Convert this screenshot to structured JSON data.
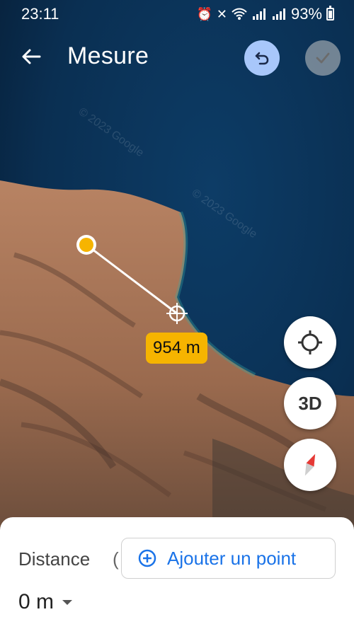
{
  "status_bar": {
    "time": "23:11",
    "battery": "93%",
    "icons": [
      "alarm-icon",
      "mute-icon",
      "wifi-icon",
      "signal-icon",
      "signal-icon",
      "battery-icon"
    ]
  },
  "header": {
    "title": "Mesure",
    "undo_icon": "undo-icon",
    "confirm_icon": "check-icon"
  },
  "map": {
    "watermark_1": "© 2023 Google",
    "watermark_2": "© 2023 Google",
    "segment_length": "954 m"
  },
  "controls": {
    "locate_icon": "crosshair-icon",
    "toggle_3d": "3D",
    "compass_icon": "compass-icon"
  },
  "sheet": {
    "distance_label": "Distance",
    "distance_clip": "(",
    "add_point": "Ajouter un point",
    "total_value": "0 m"
  },
  "colors": {
    "accent": "#1a73e8",
    "undo_bg": "#a8c7fa",
    "label_bg": "#f6b400"
  }
}
